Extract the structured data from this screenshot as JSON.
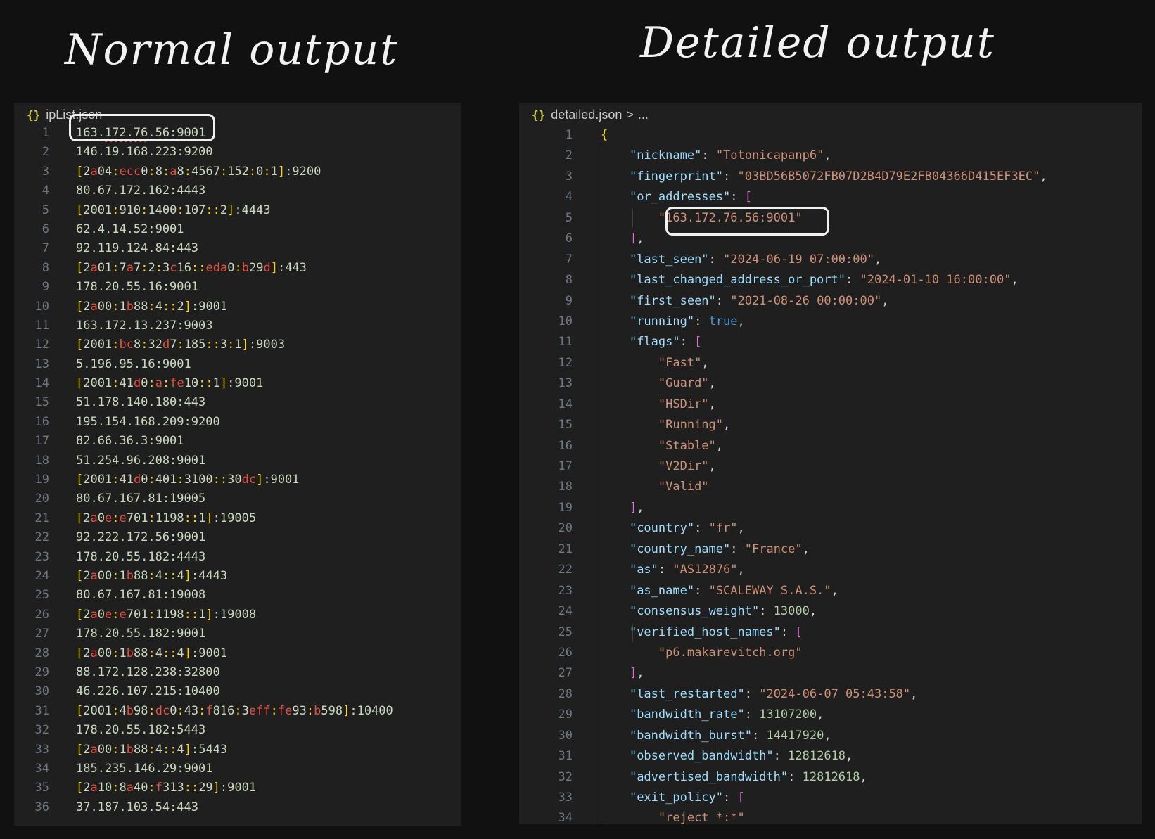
{
  "headings": {
    "left": "Normal output",
    "right": "Detailed output"
  },
  "left_editor": {
    "tab_label": "ipList.json",
    "tab_icon": "json-braces-icon",
    "lines": [
      "163.172.76.56:9001",
      "146.19.168.223:9200",
      "[2a04:ecc0:8:a8:4567:152:0:1]:9200",
      "80.67.172.162:4443",
      "[2001:910:1400:107::2]:4443",
      "62.4.14.52:9001",
      "92.119.124.84:443",
      "[2a01:7a7:2:3c16::eda0:b29d]:443",
      "178.20.55.16:9001",
      "[2a00:1b88:4::2]:9001",
      "163.172.13.237:9003",
      "[2001:bc8:32d7:185::3:1]:9003",
      "5.196.95.16:9001",
      "[2001:41d0:a:fe10::1]:9001",
      "51.178.140.180:443",
      "195.154.168.209:9200",
      "82.66.36.3:9001",
      "51.254.96.208:9001",
      "[2001:41d0:401:3100::30dc]:9001",
      "80.67.167.81:19005",
      "[2a0e:e701:1198::1]:19005",
      "92.222.172.56:9001",
      "178.20.55.182:4443",
      "[2a00:1b88:4::4]:4443",
      "80.67.167.81:19008",
      "[2a0e:e701:1198::1]:19008",
      "178.20.55.182:9001",
      "[2a00:1b88:4::4]:9001",
      "88.172.128.238:32800",
      "46.226.107.215:10400",
      "[2001:4b98:dc0:43:f816:3eff:fe93:b598]:10400",
      "178.20.55.182:5443",
      "[2a00:1b88:4::4]:5443",
      "185.235.146.29:9001",
      "[2a10:8a40:f313::29]:9001",
      "37.187.103.54:443"
    ]
  },
  "right_editor": {
    "tab_label": "detailed.json",
    "breadcrumb_sep": ">",
    "breadcrumb_more": "...",
    "tab_icon": "json-braces-icon",
    "lines": [
      "{",
      "    \"nickname\": \"Totonicapanp6\",",
      "    \"fingerprint\": \"03BD56B5072FB07D2B4D79E2FB04366D415EF3EC\",",
      "    \"or_addresses\": [",
      "        \"163.172.76.56:9001\"",
      "    ],",
      "    \"last_seen\": \"2024-06-19 07:00:00\",",
      "    \"last_changed_address_or_port\": \"2024-01-10 16:00:00\",",
      "    \"first_seen\": \"2021-08-26 00:00:00\",",
      "    \"running\": true,",
      "    \"flags\": [",
      "        \"Fast\",",
      "        \"Guard\",",
      "        \"HSDir\",",
      "        \"Running\",",
      "        \"Stable\",",
      "        \"V2Dir\",",
      "        \"Valid\"",
      "    ],",
      "    \"country\": \"fr\",",
      "    \"country_name\": \"France\",",
      "    \"as\": \"AS12876\",",
      "    \"as_name\": \"SCALEWAY S.A.S.\",",
      "    \"consensus_weight\": 13000,",
      "    \"verified_host_names\": [",
      "        \"p6.makarevitch.org\"",
      "    ],",
      "    \"last_restarted\": \"2024-06-07 05:43:58\",",
      "    \"bandwidth_rate\": 13107200,",
      "    \"bandwidth_burst\": 14417920,",
      "    \"observed_bandwidth\": 12812618,",
      "    \"advertised_bandwidth\": 12812618,",
      "    \"exit_policy\": [",
      "        \"reject *:*\""
    ]
  },
  "colors": {
    "background": "#111112",
    "editor_bg": "#1f1f1f",
    "line_number": "#6e7681",
    "json_key": "#9cdcfe",
    "json_string": "#ce9178",
    "json_number": "#b5cea8",
    "json_boolean": "#569cd6",
    "bracket_level1": "#ffd700",
    "bracket_level2": "#da70d6",
    "hex_highlight": "#e35040",
    "highlight_outline": "#f0f0f0"
  }
}
